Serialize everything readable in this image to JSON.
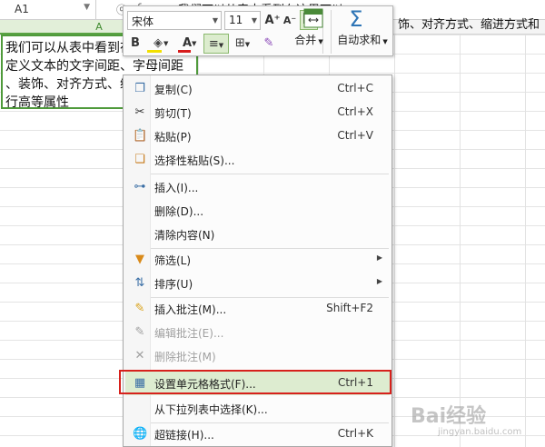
{
  "formula_bar": {
    "cell_ref": "A1",
    "formula_text": "我们可以从表中看到在这里可以",
    "overflow_text": "饰、对齐方式、缩进方式和"
  },
  "column_header": {
    "col_a": "A"
  },
  "cell": {
    "text": "我们可以从表中看到在\n定义文本的文字间距、字母间距\n、装饰、对齐方式、缩进方式和\n行高等属性"
  },
  "mini_toolbar": {
    "font_name": "宋体",
    "font_size": "11",
    "grow_font": "A⁺",
    "shrink_font": "A⁻",
    "bold": "B",
    "font_color": "A",
    "merge_label": "合并",
    "autosum_label": "自动求和"
  },
  "context_menu": {
    "items": [
      {
        "label": "复制(C)",
        "shortcut": "Ctrl+C",
        "icon": "copy-icon"
      },
      {
        "label": "剪切(T)",
        "shortcut": "Ctrl+X",
        "icon": "cut-icon"
      },
      {
        "label": "粘贴(P)",
        "shortcut": "Ctrl+V",
        "icon": "paste-icon"
      },
      {
        "label": "选择性粘贴(S)...",
        "shortcut": "",
        "icon": "paste-special-icon"
      },
      {
        "label": "插入(I)...",
        "shortcut": "",
        "icon": "insert-icon"
      },
      {
        "label": "删除(D)...",
        "shortcut": "",
        "icon": ""
      },
      {
        "label": "清除内容(N)",
        "shortcut": "",
        "icon": ""
      },
      {
        "label": "筛选(L)",
        "shortcut": "",
        "icon": "filter-icon"
      },
      {
        "label": "排序(U)",
        "shortcut": "",
        "icon": "sort-icon"
      },
      {
        "label": "插入批注(M)...",
        "shortcut": "Shift+F2",
        "icon": "insert-comment-icon"
      },
      {
        "label": "编辑批注(E)...",
        "shortcut": "",
        "icon": "edit-comment-icon"
      },
      {
        "label": "删除批注(M)",
        "shortcut": "",
        "icon": "delete-comment-icon"
      },
      {
        "label": "设置单元格格式(F)...",
        "shortcut": "Ctrl+1",
        "icon": "format-cells-icon"
      },
      {
        "label": "从下拉列表中选择(K)...",
        "shortcut": "",
        "icon": ""
      },
      {
        "label": "超链接(H)...",
        "shortcut": "Ctrl+K",
        "icon": "hyperlink-icon"
      }
    ]
  },
  "watermark": {
    "text": "Bai经验",
    "sub": "jingyan.baidu.com"
  }
}
